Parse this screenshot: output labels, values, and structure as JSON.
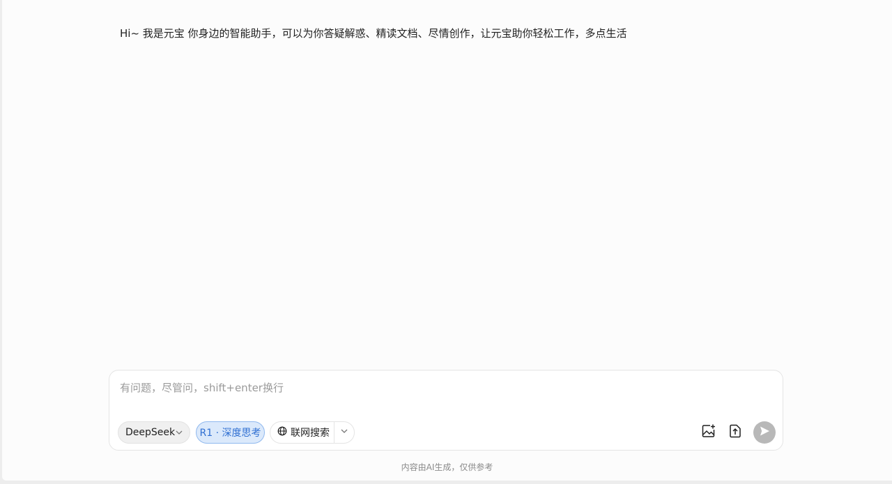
{
  "greeting": {
    "text": "Hi~ 我是元宝 你身边的智能助手，可以为你答疑解惑、精读文档、尽情创作，让元宝助你轻松工作，多点生活"
  },
  "composer": {
    "placeholder": "有问题，尽管问，shift+enter换行",
    "value": "",
    "model_label": "DeepSeek",
    "deep_think_label": "R1 · 深度思考",
    "web_search_label": "联网搜索"
  },
  "icons": {
    "model_dropdown": "chevron-down-icon",
    "web_search": "globe-icon",
    "search_dropdown": "chevron-down-icon",
    "image_upload": "image-add-icon",
    "file_upload": "file-upload-icon",
    "send": "send-icon"
  },
  "colors": {
    "accent": "#2f6fd2",
    "accent_bg": "#dbe9fb",
    "send_disabled": "#b8b8b8"
  },
  "footer": {
    "disclaimer": "内容由AI生成，仅供参考"
  }
}
